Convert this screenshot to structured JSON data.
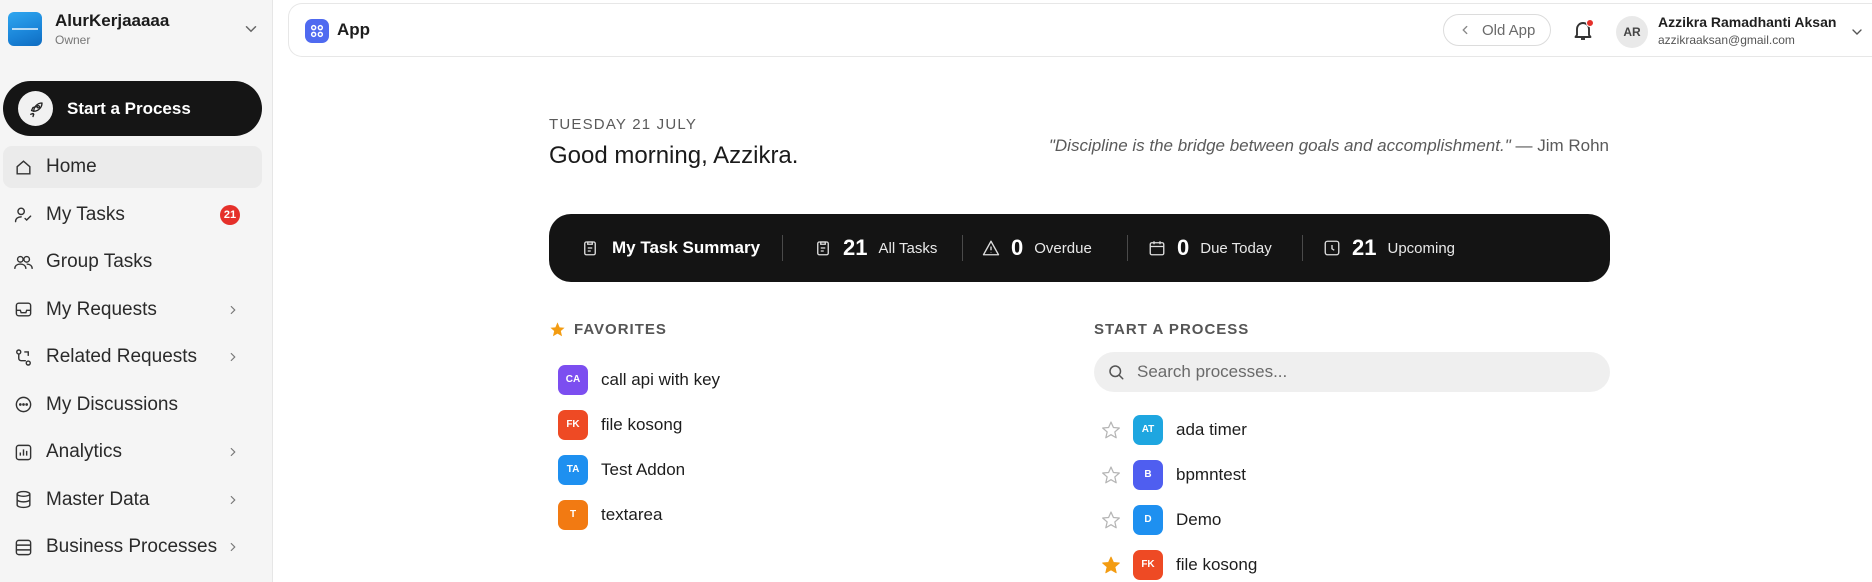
{
  "sidebar": {
    "org_name": "AlurKerjaaaaa",
    "org_role": "Owner",
    "start_button": "Start a Process",
    "items": [
      {
        "label": "Home",
        "icon": "home-icon",
        "active": true
      },
      {
        "label": "My Tasks",
        "icon": "user-check-icon",
        "badge": "21"
      },
      {
        "label": "Group Tasks",
        "icon": "users-icon"
      },
      {
        "label": "My Requests",
        "icon": "inbox-icon",
        "chevron": true
      },
      {
        "label": "Related Requests",
        "icon": "flow-icon",
        "chevron": true
      },
      {
        "label": "My Discussions",
        "icon": "chat-icon"
      },
      {
        "label": "Analytics",
        "icon": "chart-icon",
        "chevron": true
      },
      {
        "label": "Master Data",
        "icon": "database-icon",
        "chevron": true
      },
      {
        "label": "Business Processes",
        "icon": "layers-icon",
        "chevron": true
      }
    ]
  },
  "header": {
    "app_title": "App",
    "old_app_label": "Old App",
    "avatar_initials": "AR",
    "user_name": "Azzikra Ramadhanti Aksan",
    "user_email": "azzikraaksan@gmail.com"
  },
  "main": {
    "date": "TUESDAY 21 JULY",
    "greeting": "Good morning, Azzikra.",
    "quote": "\"Discipline is the bridge between goals and accomplishment.\"",
    "quote_author": "— Jim Rohn",
    "summary": {
      "title": "My Task Summary",
      "all_tasks": {
        "count": "21",
        "label": "All Tasks"
      },
      "overdue": {
        "count": "0",
        "label": "Overdue"
      },
      "due_today": {
        "count": "0",
        "label": "Due Today"
      },
      "upcoming": {
        "count": "21",
        "label": "Upcoming"
      }
    },
    "favorites": {
      "heading": "FAVORITES",
      "items": [
        {
          "initials": "CA",
          "label": "call api with key",
          "color": "#7c4ef0"
        },
        {
          "initials": "FK",
          "label": "file kosong",
          "color": "#ee4a24"
        },
        {
          "initials": "TA",
          "label": "Test Addon",
          "color": "#1e90f0"
        },
        {
          "initials": "T",
          "label": "textarea",
          "color": "#f27a12"
        }
      ]
    },
    "start_process": {
      "heading": "START A PROCESS",
      "search_placeholder": "Search processes...",
      "items": [
        {
          "initials": "AT",
          "label": "ada timer",
          "color": "#1ea6e0",
          "starred": false
        },
        {
          "initials": "B",
          "label": "bpmntest",
          "color": "#4f5ef0",
          "starred": false
        },
        {
          "initials": "D",
          "label": "Demo",
          "color": "#1e90f0",
          "starred": false
        },
        {
          "initials": "FK",
          "label": "file kosong",
          "color": "#ee4a24",
          "starred": true
        }
      ]
    }
  },
  "colors": {
    "accent": "#4f6af0",
    "badge": "#e5302a",
    "summary_bg": "#141414",
    "star_active": "#f39c12"
  }
}
